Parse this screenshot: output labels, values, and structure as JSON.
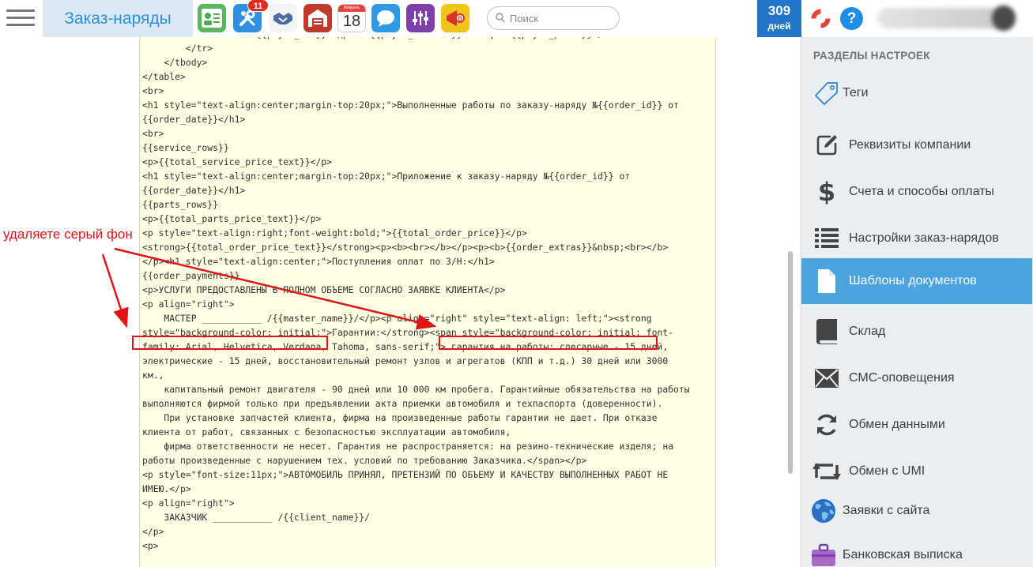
{
  "header": {
    "app_title": "Заказ-наряды",
    "notifications_badge": "11",
    "calendar_month": "Февраль",
    "calendar_day": "18",
    "search_placeholder": "Поиск",
    "days_count": "309",
    "days_label": "дней",
    "help_label": "?"
  },
  "editor": {
    "lines": [
      "            <td>ИНН: {{payer_inn}} адрес: {{payer_address}} телефон {{payer_phone}}</td>",
      "        </tr>",
      "    </tbody>",
      "</table>",
      "<br>",
      "<h1 style=\"text-align:center;margin-top:20px;\">Выполненные работы по заказу-наряду №{{order_id}} от",
      "{{order_date}}</h1>",
      "<br>",
      "{{service_rows}}",
      "<p>{{total_service_price_text}}</p>",
      "<h1 style=\"text-align:center;margin-top:20px;\">Приложение к заказу-наряду №{{order_id}} от",
      "{{order_date}}</h1>",
      "{{parts_rows}}",
      "<p>{{total_parts_price_text}}</p>",
      "<p style=\"text-align:right;font-weight:bold;\">{{total_order_price}}</p>",
      "<strong>{{total_order_price_text}}</strong><p><b><br></b></p><p><b>{{order_extras}}&nbsp;<br></b>",
      "</p><h1 style=\"text-align:center;\">Поступления оплат по З/Н:</h1>",
      "{{order_payments}}",
      "<p>УСЛУГИ ПРЕДОСТАВЛЕНЫ В ПОЛНОМ ОБЪЕМЕ СОГЛАСНО ЗАЯВКЕ КЛИЕНТА</p>",
      "<p align=\"right\">",
      "    МАСТЕР ___________ /{{master_name}}/</p><p align=\"right\" style=\"text-align: left;\"><strong",
      "style=\"background-color: initial;\">Гарантии:</strong><span style=\"background-color: initial; font-",
      "family: Arial, Helvetica, Verdana, Tahoma, sans-serif;\"> гарантия на работы: слесарные - 15 дней,",
      "электрические - 15 дней, восстановительный ремонт узлов и агрегатов (КПП и т.д.) 30 дней или 3000",
      "км.,",
      "    капитальный ремонт двигателя - 90 дней или 10 000 км пробега. Гарантийные обязательства на работы",
      "выполняются фирмой только при предъявлении акта приемки автомобиля и техпаспорта (доверенности).",
      "    При установке запчастей клиента, фирма на произведенные работы гарантии не дает. При отказе",
      "клиента от работ, связанных с безопасностью эксплуатации автомобиля,",
      "    фирма ответственности не несет. Гарантия не распространяется: на резино-технические изделя; на",
      "работы произведенные с нарушением тех. условий по требованию Заказчика.</span></p>",
      "<p style=\"font-size:11px;\">АВТОМОБИЛЬ ПРИНЯЛ, ПРЕТЕНЗИЙ ПО ОБЪЕМУ И КАЧЕСТВУ ВЫПОЛНЕННЫХ РАБОТ НЕ",
      "ИМЕЮ.</p>",
      "<p align=\"right\">",
      "    ЗАКАЗЧИК ___________ /{{client_name}}/",
      "</p>",
      "<p>"
    ]
  },
  "annotation": {
    "text": "удаляете серый фон"
  },
  "settings_panel": {
    "heading": "РАЗДЕЛЫ НАСТРОЕК",
    "items": [
      {
        "label": "Теги",
        "icon": "tag-icon"
      },
      {
        "label": "Реквизиты компании",
        "icon": "edit-icon"
      },
      {
        "label": "Счета и способы оплаты",
        "icon": "dollar-icon"
      },
      {
        "label": "Настройки заказ-нарядов",
        "icon": "list-icon"
      },
      {
        "label": "Шаблоны документов",
        "icon": "document-icon",
        "active": true
      },
      {
        "label": "Склад",
        "icon": "book-icon"
      },
      {
        "label": "СМС-оповещения",
        "icon": "envelope-icon"
      },
      {
        "label": "Обмен данными",
        "icon": "sync-icon"
      },
      {
        "label": "Обмен с UMI",
        "icon": "retweet-icon"
      },
      {
        "label": "Заявки с сайта",
        "icon": "globe-icon"
      },
      {
        "label": "Банковская выписка",
        "icon": "briefcase-icon"
      }
    ]
  },
  "colors": {
    "accent": "#2275c8",
    "active_item": "#4aa3df",
    "annotation": "#e01515",
    "editor_bg": "#fefee4"
  }
}
